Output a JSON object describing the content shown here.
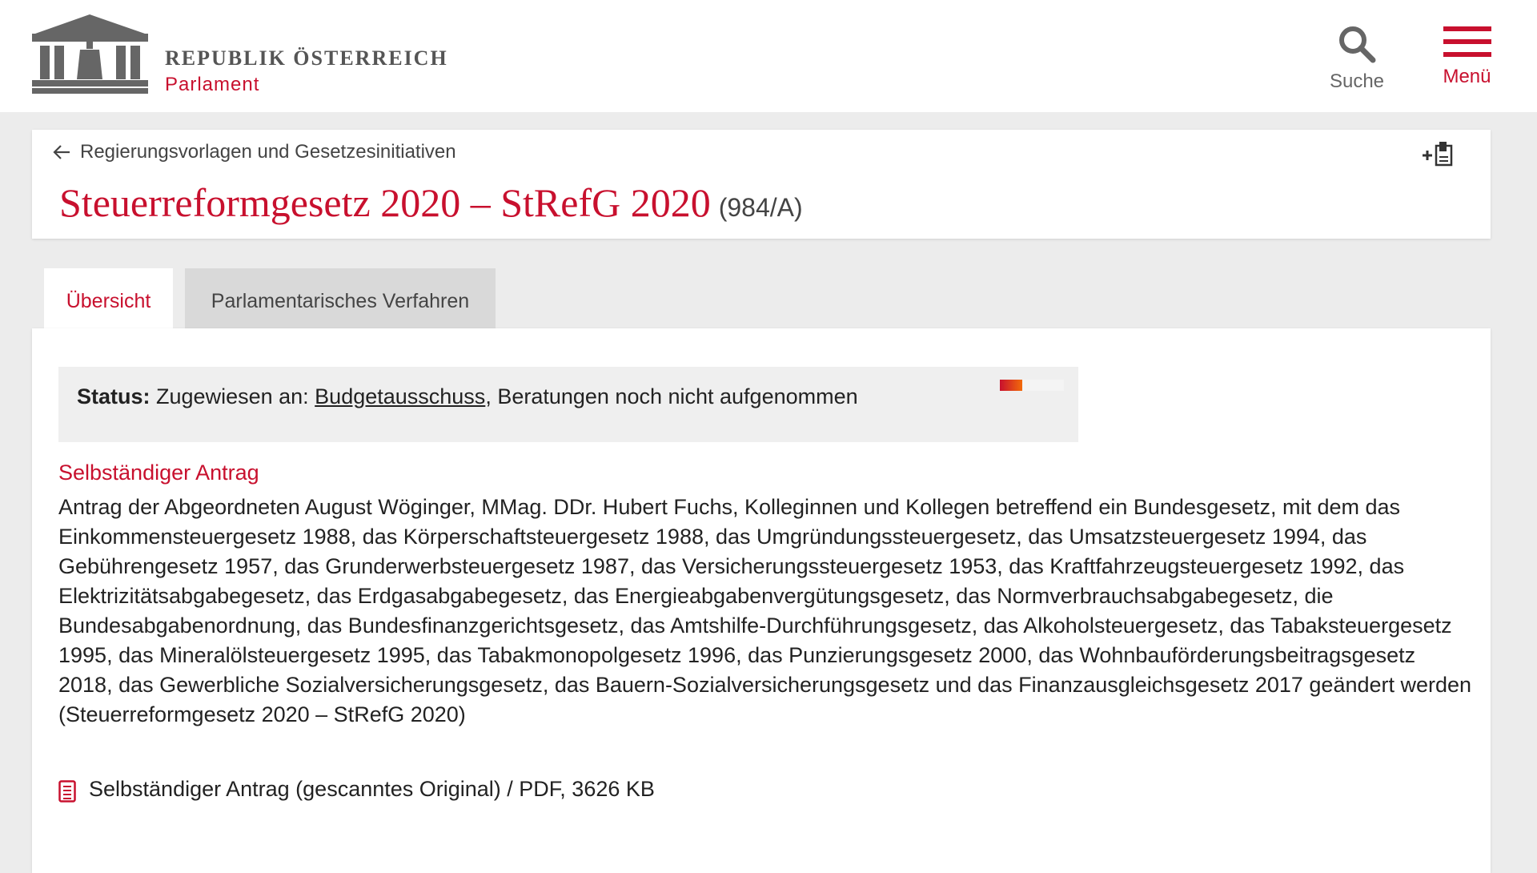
{
  "header": {
    "brand_title": "REPUBLIK ÖSTERREICH",
    "brand_subtitle": "Parlament",
    "search_label": "Suche",
    "menu_label": "Menü"
  },
  "breadcrumb": {
    "back_label": "Regierungsvorlagen und Gesetzesinitiativen"
  },
  "title": {
    "main": "Steuerreformgesetz 2020 – StRefG 2020",
    "number": "(984/A)"
  },
  "tabs": [
    {
      "label": "Übersicht",
      "active": true
    },
    {
      "label": "Parlamentarisches Verfahren",
      "active": false
    }
  ],
  "status": {
    "label": "Status:",
    "prefix": "Zugewiesen an:",
    "committee": "Budgetausschuss",
    "suffix": ", Beratungen noch nicht aufgenommen",
    "progress_percent": 35
  },
  "document": {
    "type_label": "Selbständiger Antrag",
    "description": "Antrag der Abgeordneten August Wöginger, MMag. DDr. Hubert Fuchs, Kolleginnen und Kollegen betreffend ein Bundesgesetz, mit dem das Einkommensteuergesetz 1988, das Körperschaftsteuergesetz 1988, das Umgründungssteuergesetz, das Umsatzsteuergesetz 1994, das Gebührengesetz 1957, das Grunderwerbsteuergesetz 1987, das Versicherungssteuergesetz 1953, das Kraftfahrzeugsteuergesetz 1992, das Elektrizitätsabgabegesetz, das Erdgasabgabegesetz, das Energieabgabenvergütungsgesetz, das Normverbrauchsabgabegesetz, die Bundesabgabenordnung, das Bundesfinanzgerichtsgesetz, das Amtshilfe-Durchführungsgesetz, das Alkoholsteuergesetz, das Tabaksteuergesetz 1995, das Mineralölsteuergesetz 1995, das Tabakmonopolgesetz 1996, das Punzierungsgesetz 2000, das Wohnbauförderungsbeitragsgesetz 2018, das Gewerbliche Sozialversicherungsgesetz, das Bauern-Sozialversicherungsgesetz und das Finanzausgleichsgesetz 2017 geändert werden (Steuerreformgesetz 2020 – StRefG 2020)",
    "attachment_label": "Selbständiger Antrag (gescanntes Original) / PDF, 3626 KB"
  },
  "colors": {
    "accent": "#c8102e",
    "background": "#ececec",
    "status_box": "#efefef"
  },
  "icons": {
    "logo": "parliament-building-logo",
    "search": "search-icon",
    "menu": "hamburger-menu-icon",
    "back": "arrow-left-icon",
    "add_doc": "add-document-icon",
    "attachment": "pdf-document-icon"
  }
}
